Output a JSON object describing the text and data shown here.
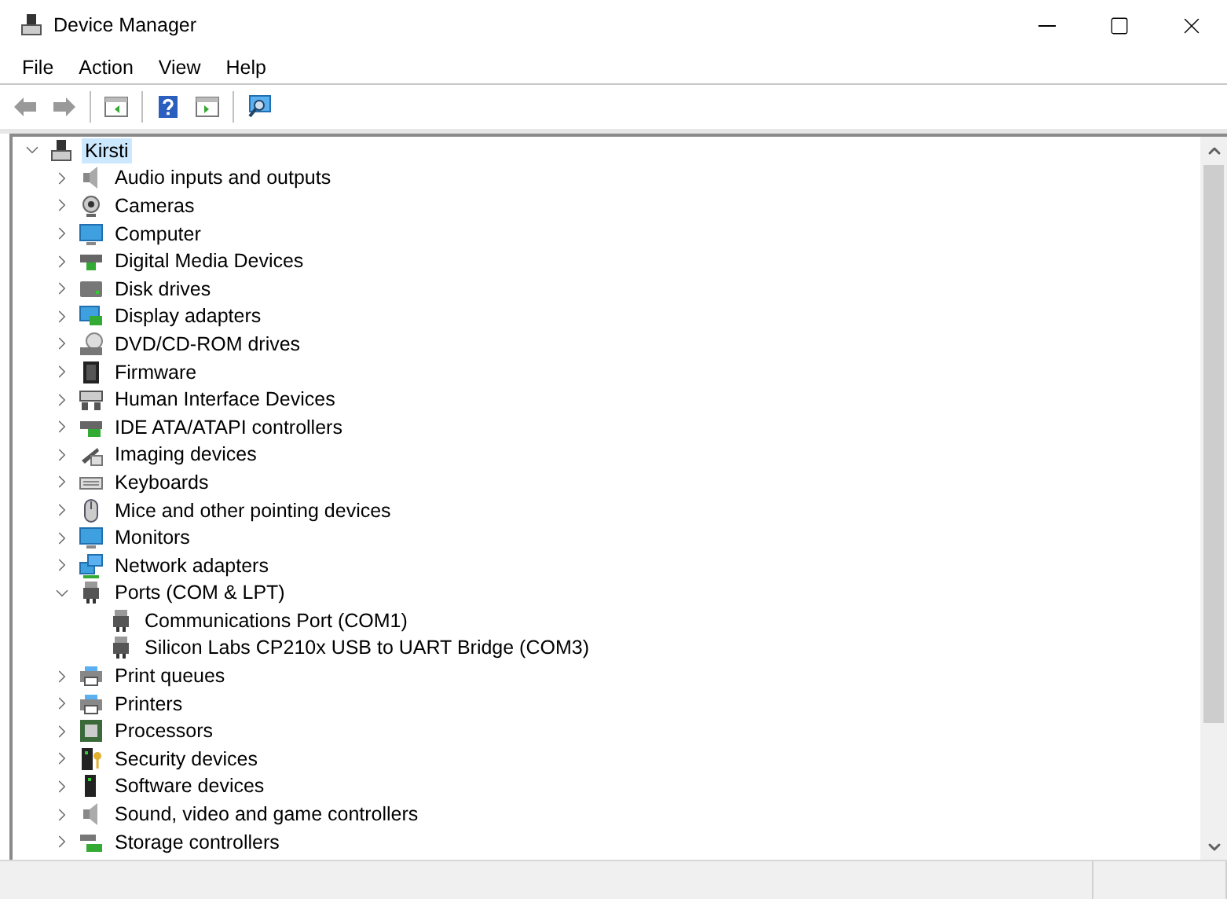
{
  "window": {
    "title": "Device Manager"
  },
  "menu": [
    {
      "label": "File"
    },
    {
      "label": "Action"
    },
    {
      "label": "View"
    },
    {
      "label": "Help"
    }
  ],
  "toolbar": [
    {
      "kind": "back",
      "disabled": false
    },
    {
      "kind": "forward",
      "disabled": false
    },
    {
      "kind": "sep"
    },
    {
      "kind": "console"
    },
    {
      "kind": "sep"
    },
    {
      "kind": "help"
    },
    {
      "kind": "action"
    },
    {
      "kind": "sep"
    },
    {
      "kind": "scan"
    }
  ],
  "tree": {
    "label": "Kirsti",
    "expanded": true,
    "selected": true,
    "children": [
      {
        "label": "Audio inputs and outputs",
        "expanded": false
      },
      {
        "label": "Cameras",
        "expanded": false
      },
      {
        "label": "Computer",
        "expanded": false
      },
      {
        "label": "Digital Media Devices",
        "expanded": false
      },
      {
        "label": "Disk drives",
        "expanded": false
      },
      {
        "label": "Display adapters",
        "expanded": false
      },
      {
        "label": "DVD/CD-ROM drives",
        "expanded": false
      },
      {
        "label": "Firmware",
        "expanded": false
      },
      {
        "label": "Human Interface Devices",
        "expanded": false
      },
      {
        "label": "IDE ATA/ATAPI controllers",
        "expanded": false
      },
      {
        "label": "Imaging devices",
        "expanded": false
      },
      {
        "label": "Keyboards",
        "expanded": false
      },
      {
        "label": "Mice and other pointing devices",
        "expanded": false
      },
      {
        "label": "Monitors",
        "expanded": false
      },
      {
        "label": "Network adapters",
        "expanded": false
      },
      {
        "label": "Ports (COM & LPT)",
        "expanded": true,
        "children": [
          {
            "label": "Communications Port (COM1)"
          },
          {
            "label": "Silicon Labs CP210x USB to UART Bridge (COM3)"
          }
        ]
      },
      {
        "label": "Print queues",
        "expanded": false
      },
      {
        "label": "Printers",
        "expanded": false
      },
      {
        "label": "Processors",
        "expanded": false
      },
      {
        "label": "Security devices",
        "expanded": false
      },
      {
        "label": "Software devices",
        "expanded": false
      },
      {
        "label": "Sound, video and game controllers",
        "expanded": false
      },
      {
        "label": "Storage controllers",
        "expanded": false
      }
    ]
  }
}
